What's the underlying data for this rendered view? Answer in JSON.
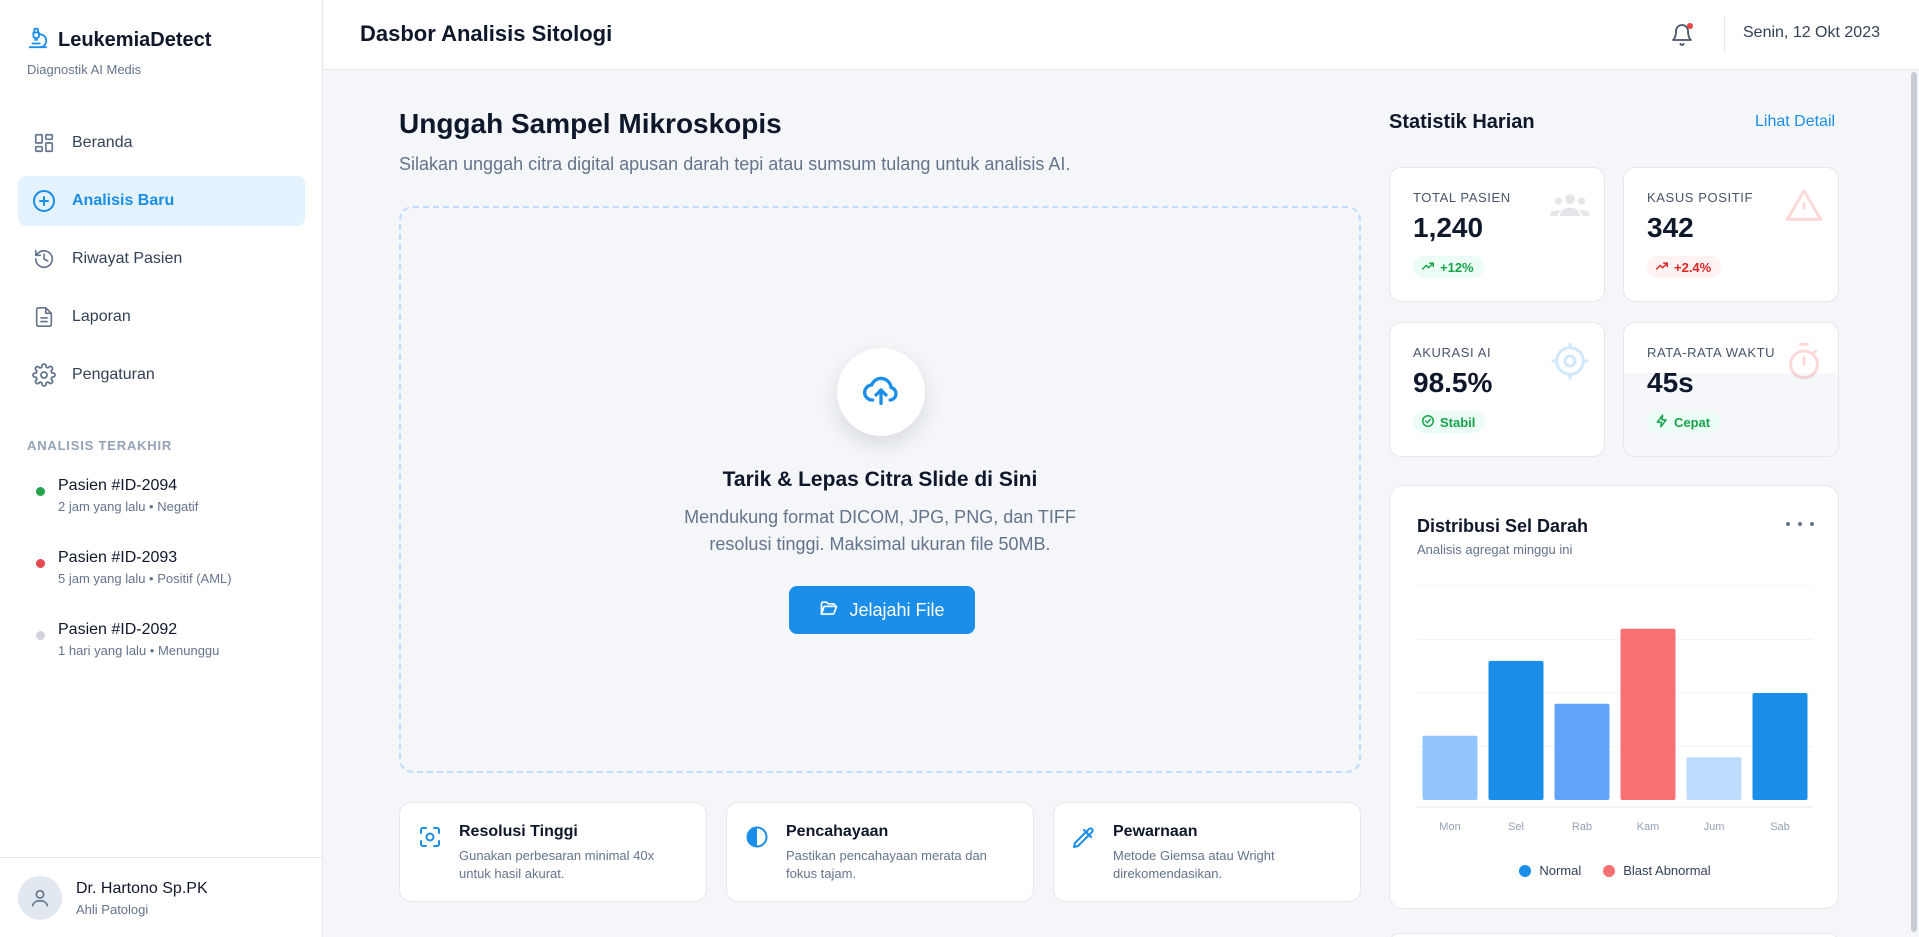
{
  "brand": {
    "title": "LeukemiaDetect",
    "subtitle": "Diagnostik AI Medis"
  },
  "nav": {
    "items": [
      {
        "label": "Beranda",
        "icon": "dashboard-icon"
      },
      {
        "label": "Analisis Baru",
        "icon": "plus-circle-icon",
        "active": true
      },
      {
        "label": "Riwayat Pasien",
        "icon": "history-icon"
      },
      {
        "label": "Laporan",
        "icon": "document-icon"
      },
      {
        "label": "Pengaturan",
        "icon": "gear-icon"
      }
    ]
  },
  "recent": {
    "label": "ANALISIS TERAKHIR",
    "items": [
      {
        "name": "Pasien #ID-2094",
        "meta": "2 jam yang lalu • Negatif",
        "color": "#22a34a"
      },
      {
        "name": "Pasien #ID-2093",
        "meta": "5 jam yang lalu • Positif (AML)",
        "color": "#e5484d"
      },
      {
        "name": "Pasien #ID-2092",
        "meta": "1 hari yang lalu • Menunggu",
        "color": "#d1d5db"
      }
    ]
  },
  "user": {
    "name": "Dr. Hartono Sp.PK",
    "role": "Ahli Patologi"
  },
  "header": {
    "title": "Dasbor Analisis Sitologi",
    "date": "Senin, 12 Okt 2023"
  },
  "upload": {
    "title": "Unggah Sampel Mikroskopis",
    "subtitle": "Silakan unggah citra digital apusan darah tepi atau sumsum tulang untuk analisis AI.",
    "drop_title": "Tarik & Lepas Citra Slide di Sini",
    "drop_desc": "Mendukung format DICOM, JPG, PNG, dan TIFF resolusi tinggi. Maksimal ukuran file 50MB.",
    "browse_label": "Jelajahi File"
  },
  "tips": [
    {
      "title": "Resolusi Tinggi",
      "desc": "Gunakan perbesaran minimal 40x untuk hasil akurat.",
      "icon": "focus-icon"
    },
    {
      "title": "Pencahayaan",
      "desc": "Pastikan pencahayaan merata dan fokus tajam.",
      "icon": "contrast-icon"
    },
    {
      "title": "Pewarnaan",
      "desc": "Metode Giemsa atau Wright direkomendasikan.",
      "icon": "eyedropper-icon"
    }
  ],
  "stats": {
    "title": "Statistik Harian",
    "detail_link": "Lihat Detail",
    "cards": [
      {
        "label": "TOTAL PASIEN",
        "value": "1,240",
        "badge": "+12%",
        "tone": "green",
        "badge_icon": "trend-up-icon",
        "icon": "users-icon"
      },
      {
        "label": "KASUS POSITIF",
        "value": "342",
        "badge": "+2.4%",
        "tone": "red",
        "badge_icon": "trend-up-icon",
        "icon": "warning-icon"
      },
      {
        "label": "AKURASI AI",
        "value": "98.5%",
        "badge": "Stabil",
        "tone": "green",
        "badge_icon": "check-circle-icon",
        "icon": "target-icon"
      },
      {
        "label": "RATA-RATA WAKTU",
        "value": "45s",
        "badge": "Cepat",
        "tone": "green",
        "badge_icon": "bolt-icon",
        "icon": "stopwatch-icon"
      }
    ]
  },
  "chart": {
    "title": "Distribusi Sel Darah",
    "subtitle": "Analisis agregat minggu ini"
  },
  "chart_data": {
    "type": "bar",
    "title": "Distribusi Sel Darah",
    "subtitle": "Analisis agregat minggu ini",
    "categories": [
      "Mon",
      "Sel",
      "Rab",
      "Kam",
      "Jum",
      "Sab"
    ],
    "values": [
      30,
      65,
      45,
      80,
      20,
      50
    ],
    "ylim": [
      0,
      100
    ],
    "bar_colors": [
      "#93c5fd",
      "#1a8ee8",
      "#60a5fa",
      "#f87171",
      "#bfdbfe",
      "#1a8ee8"
    ],
    "legend": [
      {
        "name": "Normal",
        "color": "#1a8ee8"
      },
      {
        "name": "Blast Abnormal",
        "color": "#f87171"
      }
    ],
    "legend_position": "bottom",
    "grid": true
  }
}
